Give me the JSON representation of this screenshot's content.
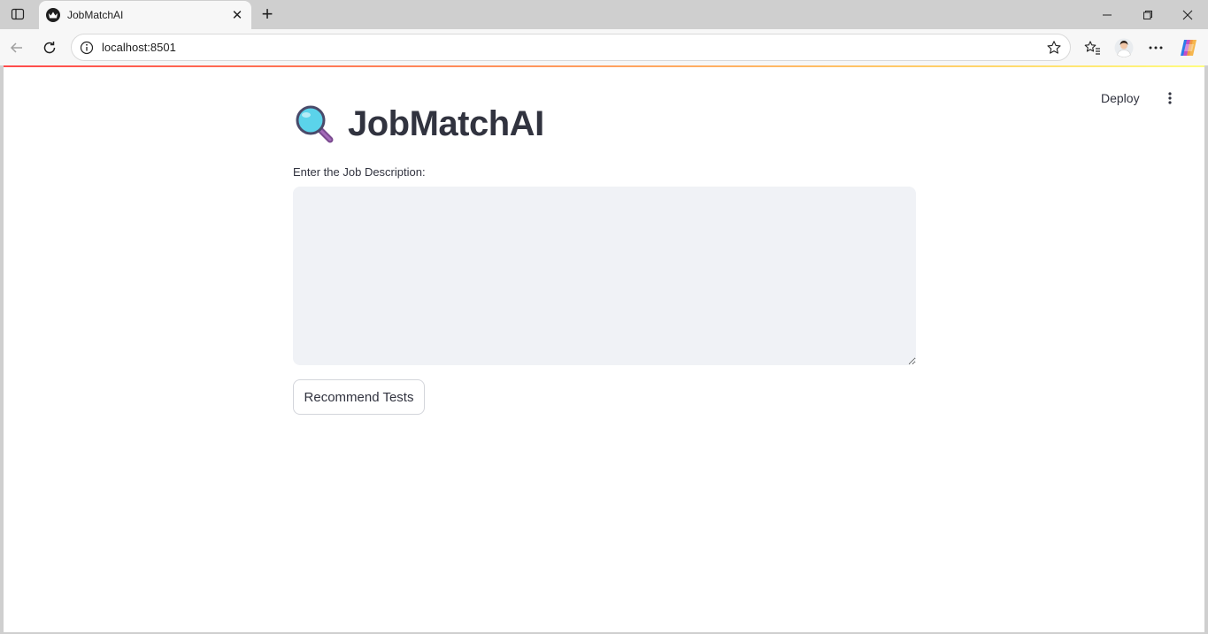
{
  "browser": {
    "tab_title": "JobMatchAI",
    "url": "localhost:8501",
    "icons": {
      "sidebar_toggle": "sidebar-icon",
      "favicon": "crown-icon",
      "close_tab": "close-icon",
      "new_tab": "plus-icon",
      "back": "back-arrow-icon",
      "reload": "reload-icon",
      "site_info": "info-icon",
      "favorite": "star-icon",
      "favorites": "favorites-icon",
      "profile": "avatar",
      "more": "more-icon",
      "copilot": "copilot-icon",
      "minimize": "minimize-icon",
      "restore": "restore-icon",
      "close_window": "close-icon"
    }
  },
  "app": {
    "toolbar": {
      "deploy_label": "Deploy",
      "menu_icon": "kebab-menu-icon"
    },
    "title": "JobMatchAI",
    "title_icon": "magnifying-glass-icon",
    "job_description_label": "Enter the Job Description:",
    "job_description_value": "",
    "recommend_button_label": "Recommend Tests"
  },
  "colors": {
    "text": "#31333f",
    "input_bg": "#f0f2f6",
    "progress_start": "#ff4b4b",
    "progress_end": "#fffd80"
  }
}
